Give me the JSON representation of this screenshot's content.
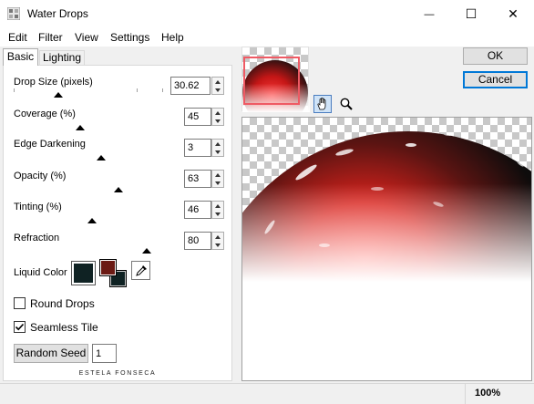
{
  "window": {
    "title": "Water Drops",
    "minimize_glyph": "—",
    "maximize_glyph": "☐",
    "close_glyph": "✕"
  },
  "menu": [
    "Edit",
    "Filter",
    "View",
    "Settings",
    "Help"
  ],
  "tabs": {
    "basic": "Basic",
    "lighting": "Lighting"
  },
  "params": [
    {
      "label": "Drop Size (pixels)",
      "value": "30.62"
    },
    {
      "label": "Coverage (%)",
      "value": "45"
    },
    {
      "label": "Edge Darkening",
      "value": "3"
    },
    {
      "label": "Opacity (%)",
      "value": "63"
    },
    {
      "label": "Tinting (%)",
      "value": "46"
    },
    {
      "label": "Refraction",
      "value": "80"
    }
  ],
  "liquid_color": {
    "label": "Liquid Color",
    "color": "#0f2223",
    "foreground": "#6b1a14",
    "background": "#0f2223"
  },
  "checks": {
    "round_drops": {
      "label": "Round Drops",
      "checked": false
    },
    "seamless_tile": {
      "label": "Seamless Tile",
      "checked": true
    }
  },
  "random_seed": {
    "button": "Random Seed",
    "value": "1"
  },
  "watermark": "ESTELA FONSECA",
  "buttons": {
    "ok": "OK",
    "cancel": "Cancel"
  },
  "tools": {
    "pan": "hand-icon",
    "zoom": "magnifier-icon"
  },
  "status": {
    "zoom": "100%"
  }
}
